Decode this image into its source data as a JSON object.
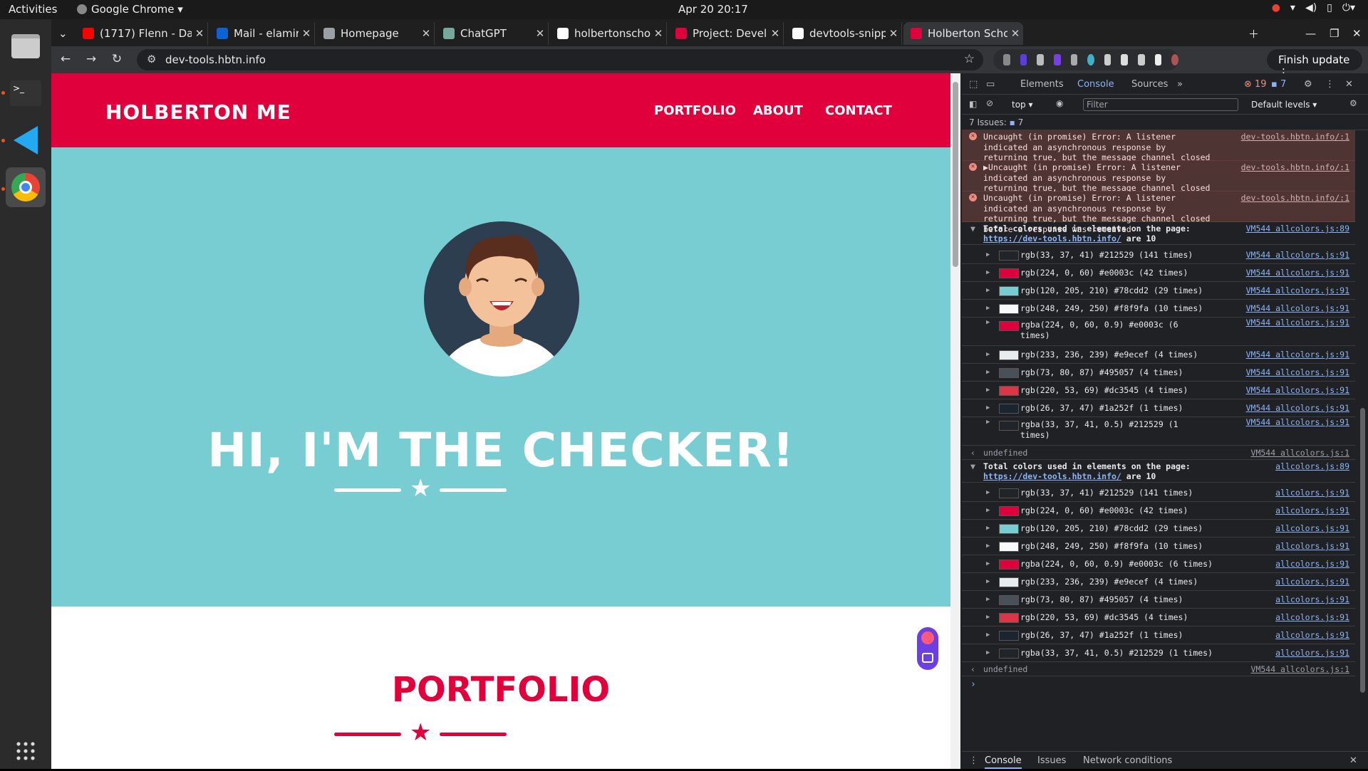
{
  "system": {
    "activities": "Activities",
    "app_name": "Google Chrome",
    "clock": "Apr 20  20:17"
  },
  "browser": {
    "tabs": [
      {
        "label": "(1717) Flenn - Da",
        "icon_color": "#ff0000",
        "icon": "youtube-icon"
      },
      {
        "label": "Mail - elamir elothm",
        "icon_color": "#0a64d6",
        "icon": "outlook-icon"
      },
      {
        "label": "Homepage",
        "icon_color": "#9aa0a6",
        "icon": "globe-icon"
      },
      {
        "label": "ChatGPT",
        "icon_color": "#74aa9c",
        "icon": "chatgpt-icon"
      },
      {
        "label": "holbertonschool-w",
        "icon_color": "#ffffff",
        "icon": "github-icon"
      },
      {
        "label": "Project: Developer",
        "icon_color": "#e0003c",
        "icon": "holberton-icon"
      },
      {
        "label": "devtools-snippets/",
        "icon_color": "#ffffff",
        "icon": "github-icon"
      },
      {
        "label": "Holberton School -",
        "icon_color": "#e0003c",
        "icon": "holberton-icon"
      }
    ],
    "url": "dev-tools.hbtn.info",
    "finish_update": "Finish update"
  },
  "page": {
    "brand": "HOLBERTON ME",
    "nav": [
      "PORTFOLIO",
      "ABOUT",
      "CONTACT"
    ],
    "hero_title": "HI, I'M THE CHECKER!",
    "portfolio_title": "PORTFOLIO"
  },
  "colors": {
    "accent": "#e0003c",
    "hero_bg": "#78cdd2"
  },
  "devtools": {
    "tabs": [
      "Elements",
      "Console",
      "Sources"
    ],
    "error_count": "19",
    "message_count": "7",
    "context": "top",
    "filter_placeholder": "Filter",
    "levels": "Default levels",
    "issues_label": "7 Issues:",
    "issues_count": "7",
    "errors": [
      {
        "text": "Uncaught (in promise) Error: A listener indicated an asynchronous response by returning true, but the message channel closed before a response was received",
        "src": "dev-tools.hbtn.info/:1"
      },
      {
        "text": "▶Uncaught (in promise) Error: A listener indicated an asynchronous response by returning true, but the message channel closed before a response was received",
        "src": "dev-tools.hbtn.info/:1"
      },
      {
        "text": "Uncaught (in promise) Error: A listener indicated an asynchronous response by returning true, but the message channel closed before a response was received",
        "src": "dev-tools.hbtn.info/:1"
      }
    ],
    "group1": {
      "title_pre": "Total colors used in elements on the page: ",
      "title_link": "https://dev-tools.hbtn.info/",
      "title_post": " are 10",
      "src": "VM544 allcolors.js:89",
      "rows": [
        {
          "text": "rgb(33, 37, 41) #212529 (141 times)",
          "swatch": "#212529",
          "src": "VM544 allcolors.js:91"
        },
        {
          "text": "rgb(224, 0, 60) #e0003c (42 times)",
          "swatch": "#e0003c",
          "src": "VM544 allcolors.js:91"
        },
        {
          "text": "rgb(120, 205, 210) #78cdd2 (29 times)",
          "swatch": "#78cdd2",
          "src": "VM544 allcolors.js:91"
        },
        {
          "text": "rgb(248, 249, 250) #f8f9fa (10 times)",
          "swatch": "#f8f9fa",
          "src": "VM544 allcolors.js:91"
        },
        {
          "text": "rgba(224, 0, 60, 0.9) #e0003c (6 times)",
          "swatch": "#e0003c",
          "src": "VM544 allcolors.js:91"
        },
        {
          "text": "rgb(233, 236, 239) #e9ecef (4 times)",
          "swatch": "#e9ecef",
          "src": "VM544 allcolors.js:91"
        },
        {
          "text": "rgb(73, 80, 87) #495057 (4 times)",
          "swatch": "#495057",
          "src": "VM544 allcolors.js:91"
        },
        {
          "text": "rgb(220, 53, 69) #dc3545 (4 times)",
          "swatch": "#dc3545",
          "src": "VM544 allcolors.js:91"
        },
        {
          "text": "rgb(26, 37, 47) #1a252f (1 times)",
          "swatch": "#1a252f",
          "src": "VM544 allcolors.js:91"
        },
        {
          "text": "rgba(33, 37, 41, 0.5) #212529 (1 times)",
          "swatch": "#212529",
          "src": "VM544 allcolors.js:91"
        }
      ]
    },
    "undefined1": {
      "text": "undefined",
      "src": "VM544 allcolors.js:1"
    },
    "group2": {
      "title_pre": "Total colors used in elements on the page: ",
      "title_link": "https://dev-tools.hbtn.info/",
      "title_post": " are 10",
      "src": "allcolors.js:89",
      "rows": [
        {
          "text": "rgb(33, 37, 41) #212529 (141 times)",
          "swatch": "#212529",
          "src": "allcolors.js:91"
        },
        {
          "text": "rgb(224, 0, 60) #e0003c (42 times)",
          "swatch": "#e0003c",
          "src": "allcolors.js:91"
        },
        {
          "text": "rgb(120, 205, 210) #78cdd2 (29 times)",
          "swatch": "#78cdd2",
          "src": "allcolors.js:91"
        },
        {
          "text": "rgb(248, 249, 250) #f8f9fa (10 times)",
          "swatch": "#f8f9fa",
          "src": "allcolors.js:91"
        },
        {
          "text": "rgba(224, 0, 60, 0.9) #e0003c (6 times)",
          "swatch": "#e0003c",
          "src": "allcolors.js:91"
        },
        {
          "text": "rgb(233, 236, 239) #e9ecef (4 times)",
          "swatch": "#e9ecef",
          "src": "allcolors.js:91"
        },
        {
          "text": "rgb(73, 80, 87) #495057 (4 times)",
          "swatch": "#495057",
          "src": "allcolors.js:91"
        },
        {
          "text": "rgb(220, 53, 69) #dc3545 (4 times)",
          "swatch": "#dc3545",
          "src": "allcolors.js:91"
        },
        {
          "text": "rgb(26, 37, 47) #1a252f (1 times)",
          "swatch": "#1a252f",
          "src": "allcolors.js:91"
        },
        {
          "text": "rgba(33, 37, 41, 0.5) #212529 (1 times)",
          "swatch": "#212529",
          "src": "allcolors.js:91"
        }
      ]
    },
    "undefined2": {
      "text": "undefined",
      "src": "VM544 allcolors.js:1"
    },
    "drawer_tabs": [
      "Console",
      "Issues",
      "Network conditions"
    ]
  }
}
